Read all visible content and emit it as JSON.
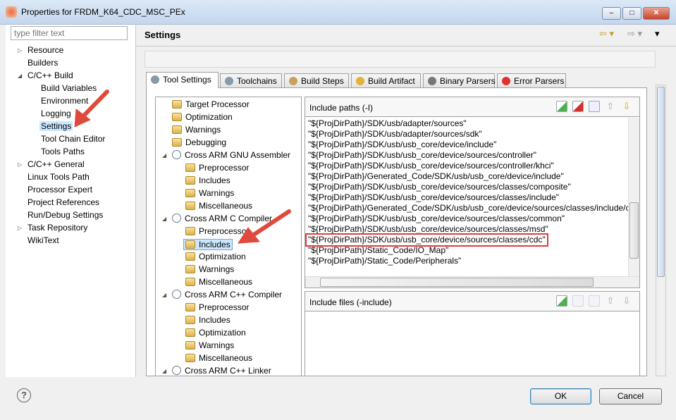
{
  "window": {
    "title": "Properties for FRDM_K64_CDC_MSC_PEx",
    "minimize": "–",
    "maximize": "□",
    "close": "✕"
  },
  "filter": {
    "placeholder": "type filter text"
  },
  "left_tree": [
    {
      "label": "Resource",
      "expander": "▷",
      "level": 0
    },
    {
      "label": "Builders",
      "level": 0
    },
    {
      "label": "C/C++ Build",
      "expander": "◢",
      "level": 0
    },
    {
      "label": "Build Variables",
      "level": 1
    },
    {
      "label": "Environment",
      "level": 1
    },
    {
      "label": "Logging",
      "level": 1
    },
    {
      "label": "Settings",
      "level": 1,
      "selected": true
    },
    {
      "label": "Tool Chain Editor",
      "level": 1
    },
    {
      "label": "Tools Paths",
      "level": 1
    },
    {
      "label": "C/C++ General",
      "expander": "▷",
      "level": 0
    },
    {
      "label": "Linux Tools Path",
      "level": 0
    },
    {
      "label": "Processor Expert",
      "level": 0
    },
    {
      "label": "Project References",
      "level": 0
    },
    {
      "label": "Run/Debug Settings",
      "level": 0
    },
    {
      "label": "Task Repository",
      "expander": "▷",
      "level": 0
    },
    {
      "label": "WikiText",
      "level": 0
    }
  ],
  "header": {
    "title": "Settings",
    "back": "⇦ ▾",
    "forward": "⇨ ▾",
    "menu": "▾"
  },
  "tabs": [
    {
      "label": "Tool Settings",
      "selected": true,
      "icon": "tool-settings-icon"
    },
    {
      "label": "Toolchains",
      "icon": "toolchains-icon"
    },
    {
      "label": "Build Steps",
      "icon": "build-steps-icon"
    },
    {
      "label": "Build Artifact",
      "icon": "build-artifact-icon"
    },
    {
      "label": "Binary Parsers",
      "icon": "binary-parsers-icon"
    },
    {
      "label": "Error Parsers",
      "icon": "error-parsers-icon"
    }
  ],
  "tool_tree": [
    {
      "label": "Target Processor",
      "level": 0,
      "type": "item"
    },
    {
      "label": "Optimization",
      "level": 0,
      "type": "item"
    },
    {
      "label": "Warnings",
      "level": 0,
      "type": "item"
    },
    {
      "label": "Debugging",
      "level": 0,
      "type": "item"
    },
    {
      "label": "Cross ARM GNU Assembler",
      "level": 0,
      "type": "group"
    },
    {
      "label": "Preprocessor",
      "level": 1,
      "type": "item"
    },
    {
      "label": "Includes",
      "level": 1,
      "type": "item"
    },
    {
      "label": "Warnings",
      "level": 1,
      "type": "item"
    },
    {
      "label": "Miscellaneous",
      "level": 1,
      "type": "item"
    },
    {
      "label": "Cross ARM C Compiler",
      "level": 0,
      "type": "group"
    },
    {
      "label": "Preprocessor",
      "level": 1,
      "type": "item"
    },
    {
      "label": "Includes",
      "level": 1,
      "type": "item",
      "selected": true
    },
    {
      "label": "Optimization",
      "level": 1,
      "type": "item"
    },
    {
      "label": "Warnings",
      "level": 1,
      "type": "item"
    },
    {
      "label": "Miscellaneous",
      "level": 1,
      "type": "item"
    },
    {
      "label": "Cross ARM C++ Compiler",
      "level": 0,
      "type": "group"
    },
    {
      "label": "Preprocessor",
      "level": 1,
      "type": "item"
    },
    {
      "label": "Includes",
      "level": 1,
      "type": "item"
    },
    {
      "label": "Optimization",
      "level": 1,
      "type": "item"
    },
    {
      "label": "Warnings",
      "level": 1,
      "type": "item"
    },
    {
      "label": "Miscellaneous",
      "level": 1,
      "type": "item"
    },
    {
      "label": "Cross ARM C++ Linker",
      "level": 0,
      "type": "group"
    }
  ],
  "include_paths": {
    "title": "Include paths (-I)",
    "items": [
      "\"${ProjDirPath}/SDK/usb/adapter/sources\"",
      "\"${ProjDirPath}/SDK/usb/adapter/sources/sdk\"",
      "\"${ProjDirPath}/SDK/usb/usb_core/device/include\"",
      "\"${ProjDirPath}/SDK/usb/usb_core/device/sources/controller\"",
      "\"${ProjDirPath}/SDK/usb/usb_core/device/sources/controller/khci\"",
      "\"${ProjDirPath}/Generated_Code/SDK/usb/usb_core/device/include\"",
      "\"${ProjDirPath}/SDK/usb/usb_core/device/sources/classes/composite\"",
      "\"${ProjDirPath}/SDK/usb/usb_core/device/sources/classes/include\"",
      "\"${ProjDirPath}/Generated_Code/SDK/usb/usb_core/device/sources/classes/include/c",
      "\"${ProjDirPath}/SDK/usb/usb_core/device/sources/classes/common\"",
      "\"${ProjDirPath}/SDK/usb/usb_core/device/sources/classes/msd\"",
      "\"${ProjDirPath}/SDK/usb/usb_core/device/sources/classes/cdc\"",
      "\"${ProjDirPath}/Static_Code/IO_Map\"",
      "\"${ProjDirPath}/Static_Code/Peripherals\""
    ],
    "highlighted_index": 11
  },
  "include_files": {
    "title": "Include files (-include)",
    "items": []
  },
  "buttons": {
    "ok": "OK",
    "cancel": "Cancel",
    "help": "?"
  },
  "colors": {
    "highlight": "#e03c3c",
    "arrow": "#e04a3c",
    "selection": "#cce8ff"
  }
}
